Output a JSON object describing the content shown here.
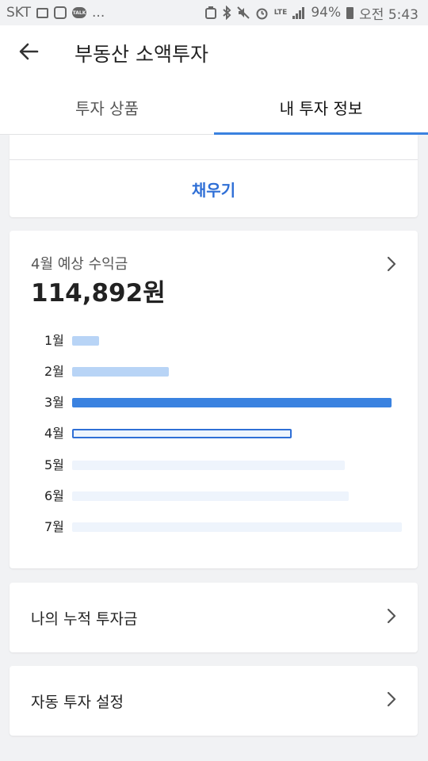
{
  "status_bar": {
    "carrier": "SKT",
    "more": "...",
    "lte": "LTE",
    "battery": "94%",
    "time": "오전 5:43"
  },
  "header": {
    "title": "부동산 소액투자",
    "back_icon": "arrow-left-icon"
  },
  "tabs": [
    {
      "label": "투자 상품",
      "active": false
    },
    {
      "label": "내 투자 정보",
      "active": true
    }
  ],
  "fill_card": {
    "button_label": "채우기"
  },
  "income_card": {
    "label": "4월 예상 수익금",
    "amount": "114,892원",
    "chevron_icon": "chevron-right-icon"
  },
  "monthly_bars": [
    {
      "month": "1월",
      "level": 0.08,
      "status": "past"
    },
    {
      "month": "2월",
      "level": 0.29,
      "status": "past"
    },
    {
      "month": "3월",
      "level": 0.96,
      "status": "highlight"
    },
    {
      "month": "4월",
      "level": 0.66,
      "status": "current"
    },
    {
      "month": "5월",
      "level": 0.82,
      "status": "future"
    },
    {
      "month": "6월",
      "level": 0.83,
      "status": "future"
    },
    {
      "month": "7월",
      "level": 0.99,
      "status": "future"
    }
  ],
  "colors": {
    "accent": "#3a82e0",
    "button_text": "#2f6fd6",
    "bar_past": "#b8d4f6",
    "bar_highlight": "#3a82e0",
    "bar_current_fill": "#eef5fd",
    "bar_current_border": "#2f6fd6",
    "bar_future": "#eef4fc"
  },
  "nav_items": [
    {
      "label": "나의 누적 투자금"
    },
    {
      "label": "자동 투자 설정"
    }
  ]
}
